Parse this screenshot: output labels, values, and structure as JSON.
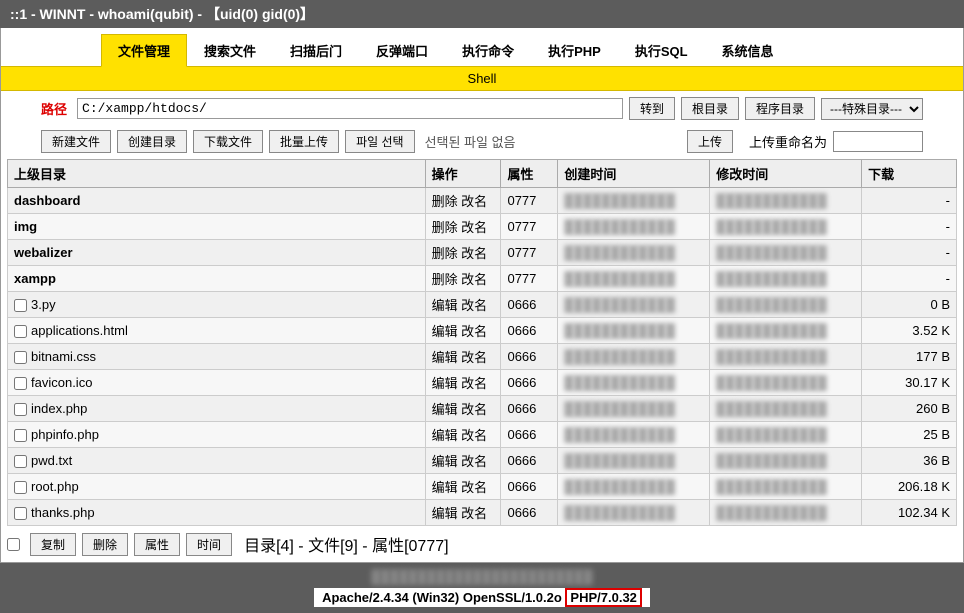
{
  "header": "::1 - WINNT - whoami(qubit) - 【uid(0) gid(0)】",
  "tabs": [
    {
      "label": "文件管理",
      "active": true
    },
    {
      "label": "搜索文件",
      "active": false
    },
    {
      "label": "扫描后门",
      "active": false
    },
    {
      "label": "反弹端口",
      "active": false
    },
    {
      "label": "执行命令",
      "active": false
    },
    {
      "label": "执行PHP",
      "active": false
    },
    {
      "label": "执行SQL",
      "active": false
    },
    {
      "label": "系统信息",
      "active": false
    }
  ],
  "shell_label": "Shell",
  "path": {
    "label": "路径",
    "value": "C:/xampp/htdocs/",
    "go": "转到",
    "root": "根目录",
    "prog": "程序目录",
    "special": "---特殊目录---"
  },
  "toolbar": {
    "new_file": "新建文件",
    "new_dir": "创建目录",
    "download": "下载文件",
    "batch_upload": "批量上传",
    "choose_file": "파일 선택",
    "no_file": "선택된 파일 없음",
    "upload": "上传",
    "rename_label": "上传重命名为"
  },
  "cols": {
    "parent": "上级目录",
    "op": "操作",
    "attr": "属性",
    "ctime": "创建时间",
    "mtime": "修改时间",
    "dl": "下载"
  },
  "rows": [
    {
      "name": "dashboard",
      "dir": true,
      "op": "删除 改名",
      "attr": "0777",
      "dl": "-"
    },
    {
      "name": "img",
      "dir": true,
      "op": "删除 改名",
      "attr": "0777",
      "dl": "-"
    },
    {
      "name": "webalizer",
      "dir": true,
      "op": "删除 改名",
      "attr": "0777",
      "dl": "-"
    },
    {
      "name": "xampp",
      "dir": true,
      "op": "删除 改名",
      "attr": "0777",
      "dl": "-"
    },
    {
      "name": "3.py",
      "dir": false,
      "op": "编辑 改名",
      "attr": "0666",
      "dl": "0 B"
    },
    {
      "name": "applications.html",
      "dir": false,
      "op": "编辑 改名",
      "attr": "0666",
      "dl": "3.52 K"
    },
    {
      "name": "bitnami.css",
      "dir": false,
      "op": "编辑 改名",
      "attr": "0666",
      "dl": "177 B"
    },
    {
      "name": "favicon.ico",
      "dir": false,
      "op": "编辑 改名",
      "attr": "0666",
      "dl": "30.17 K"
    },
    {
      "name": "index.php",
      "dir": false,
      "op": "编辑 改名",
      "attr": "0666",
      "dl": "260 B"
    },
    {
      "name": "phpinfo.php",
      "dir": false,
      "op": "编辑 改名",
      "attr": "0666",
      "dl": "25 B"
    },
    {
      "name": "pwd.txt",
      "dir": false,
      "op": "编辑 改名",
      "attr": "0666",
      "dl": "36 B"
    },
    {
      "name": "root.php",
      "dir": false,
      "op": "编辑 改名",
      "attr": "0666",
      "dl": "206.18 K"
    },
    {
      "name": "thanks.php",
      "dir": false,
      "op": "编辑 改名",
      "attr": "0666",
      "dl": "102.34 K"
    }
  ],
  "footer": {
    "copy": "复制",
    "delete": "删除",
    "attr": "属性",
    "time": "时间",
    "summary": "目录[4] - 文件[9] - 属性[0777]"
  },
  "server": {
    "prefix": "Apache/2.4.34 (Win32) OpenSSL/1.0.2o ",
    "php": "PHP/7.0.32"
  }
}
